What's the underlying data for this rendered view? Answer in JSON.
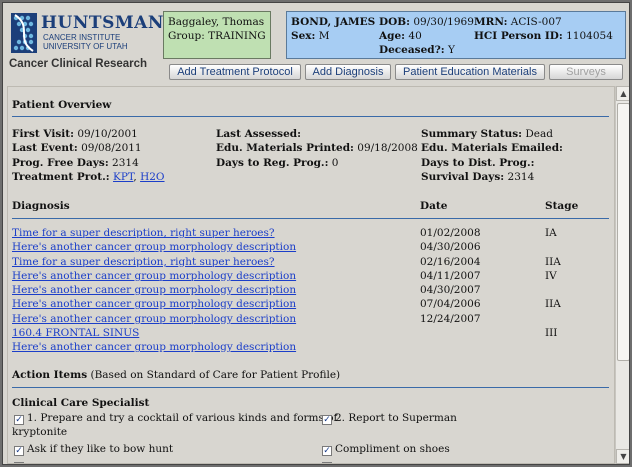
{
  "logo": {
    "title": "HUNTSMAN",
    "sub1": "CANCER INSTITUTE",
    "sub2": "UNIVERSITY OF UTAH",
    "caption": "Cancer Clinical Research",
    "mark_color": "#1c3f7a",
    "accent_color": "#6fb8e0"
  },
  "user": {
    "name": "Baggaley, Thomas",
    "group_label": "Group:",
    "group_value": "TRAINING"
  },
  "patient": {
    "name": "BOND, JAMES",
    "sex_label": "Sex:",
    "sex_value": "M",
    "dob_label": "DOB:",
    "dob_value": "09/30/1969",
    "age_label": "Age:",
    "age_value": "40",
    "deceased_label": "Deceased?:",
    "deceased_value": "Y",
    "mrn_label": "MRN:",
    "mrn_value": "ACIS-007",
    "hci_label": "HCI Person ID:",
    "hci_value": "1104054"
  },
  "buttons": {
    "add_treatment": "Add Treatment Protocol",
    "add_diagnosis": "Add Diagnosis",
    "patient_education": "Patient Education Materials",
    "surveys": "Surveys"
  },
  "overview": {
    "heading": "Patient Overview",
    "first_visit_label": "First Visit:",
    "first_visit_value": "09/10/2001",
    "last_event_label": "Last Event:",
    "last_event_value": "09/08/2011",
    "pfd_label": "Prog. Free Days:",
    "pfd_value": "2314",
    "treatment_label": "Treatment Prot.:",
    "treatment_link1": "KPT",
    "treatment_sep": ",",
    "treatment_link2": "H2O",
    "last_assessed_label": "Last Assessed:",
    "last_assessed_value": "",
    "edu_printed_label": "Edu. Materials Printed:",
    "edu_printed_value": "09/18/2008",
    "days_reg_label": "Days to Reg. Prog.:",
    "days_reg_value": "0",
    "summary_status_label": "Summary Status:",
    "summary_status_value": "Dead",
    "edu_emailed_label": "Edu. Materials Emailed:",
    "edu_emailed_value": "",
    "days_dist_label": "Days to Dist. Prog.:",
    "days_dist_value": "",
    "survival_label": "Survival Days:",
    "survival_value": "2314"
  },
  "diagnosis": {
    "col_diagnosis": "Diagnosis",
    "col_date": "Date",
    "col_stage": "Stage",
    "rows": [
      {
        "desc": "Time for a super description, right super heroes?",
        "date": "01/02/2008",
        "stage": "IA"
      },
      {
        "desc": "Here's another cancer group morphology description",
        "date": "04/30/2006",
        "stage": ""
      },
      {
        "desc": "Time for a super description, right super heroes?",
        "date": "02/16/2004",
        "stage": "IIA"
      },
      {
        "desc": "Here's another cancer group morphology description",
        "date": "04/11/2007",
        "stage": "IV"
      },
      {
        "desc": "Here's another cancer group morphology description",
        "date": "04/30/2007",
        "stage": ""
      },
      {
        "desc": "Here's another cancer group morphology description",
        "date": "07/04/2006",
        "stage": "IIA"
      },
      {
        "desc": "Here's another cancer group morphology description",
        "date": "12/24/2007",
        "stage": ""
      },
      {
        "desc": "160.4 FRONTAL SINUS",
        "date": "",
        "stage": "III"
      },
      {
        "desc": "Here's another cancer group morphology description",
        "date": "",
        "stage": ""
      }
    ]
  },
  "action_items": {
    "heading": "Action Items",
    "subheading": "(Based on Standard of Care for Patient Profile)",
    "specialist_heading": "Clinical Care Specialist",
    "items": [
      {
        "text": "1. Prepare and try a cocktail of various kinds and forms of",
        "checked": true
      },
      {
        "text": "kryptonite",
        "checked": null
      },
      {
        "text": "2. Report to Superman",
        "checked": true
      },
      {
        "text": "Ask if they like to bow hunt",
        "checked": true
      },
      {
        "text": "Compliment on shoes",
        "checked": true
      }
    ]
  }
}
